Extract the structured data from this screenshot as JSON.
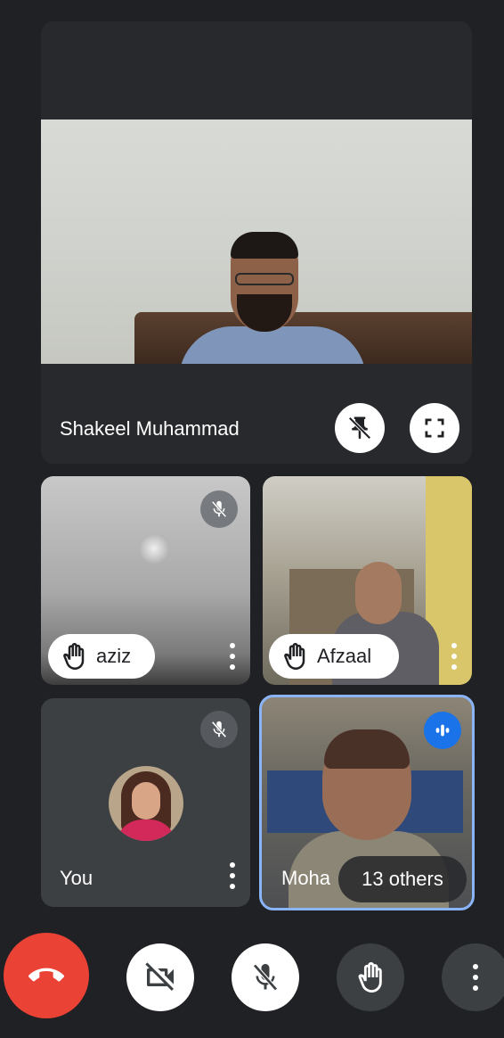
{
  "main_participant": {
    "name": "Shakeel Muhammad",
    "pin_icon": "unpin-icon",
    "fullscreen_icon": "fullscreen-icon"
  },
  "tiles": [
    {
      "name": "aziz",
      "muted": true,
      "hand_raised": true
    },
    {
      "name": "Afzaal",
      "muted": false,
      "hand_raised": true
    },
    {
      "name": "You",
      "muted": true,
      "hand_raised": false
    },
    {
      "name": "Moha",
      "speaking": true,
      "others_label": "13 others"
    }
  ],
  "controls": {
    "end_call": "phone-hangup-icon",
    "camera": "camera-off-icon",
    "microphone": "mic-off-icon",
    "raise_hand": "hand-icon",
    "more": "more-vert-icon"
  },
  "colors": {
    "background": "#202124",
    "end_call": "#ea4335",
    "speaking_border": "#8ab4f8",
    "speaking_badge": "#1a73e8"
  }
}
